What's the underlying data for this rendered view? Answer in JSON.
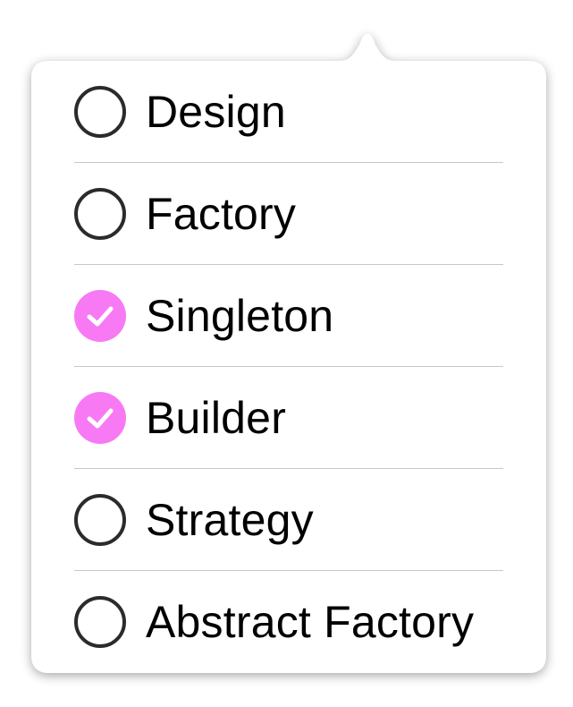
{
  "menu": {
    "accent_color": "#f77af4",
    "unchecked_stroke_color": "#2b2b2b",
    "items": [
      {
        "label": "Design",
        "checked": false,
        "icon": "radio-unchecked-icon"
      },
      {
        "label": "Factory",
        "checked": false,
        "icon": "radio-unchecked-icon"
      },
      {
        "label": "Singleton",
        "checked": true,
        "icon": "radio-checked-icon"
      },
      {
        "label": "Builder",
        "checked": true,
        "icon": "radio-checked-icon"
      },
      {
        "label": "Strategy",
        "checked": false,
        "icon": "radio-unchecked-icon"
      },
      {
        "label": "Abstract Factory",
        "checked": false,
        "icon": "radio-unchecked-icon"
      }
    ]
  }
}
